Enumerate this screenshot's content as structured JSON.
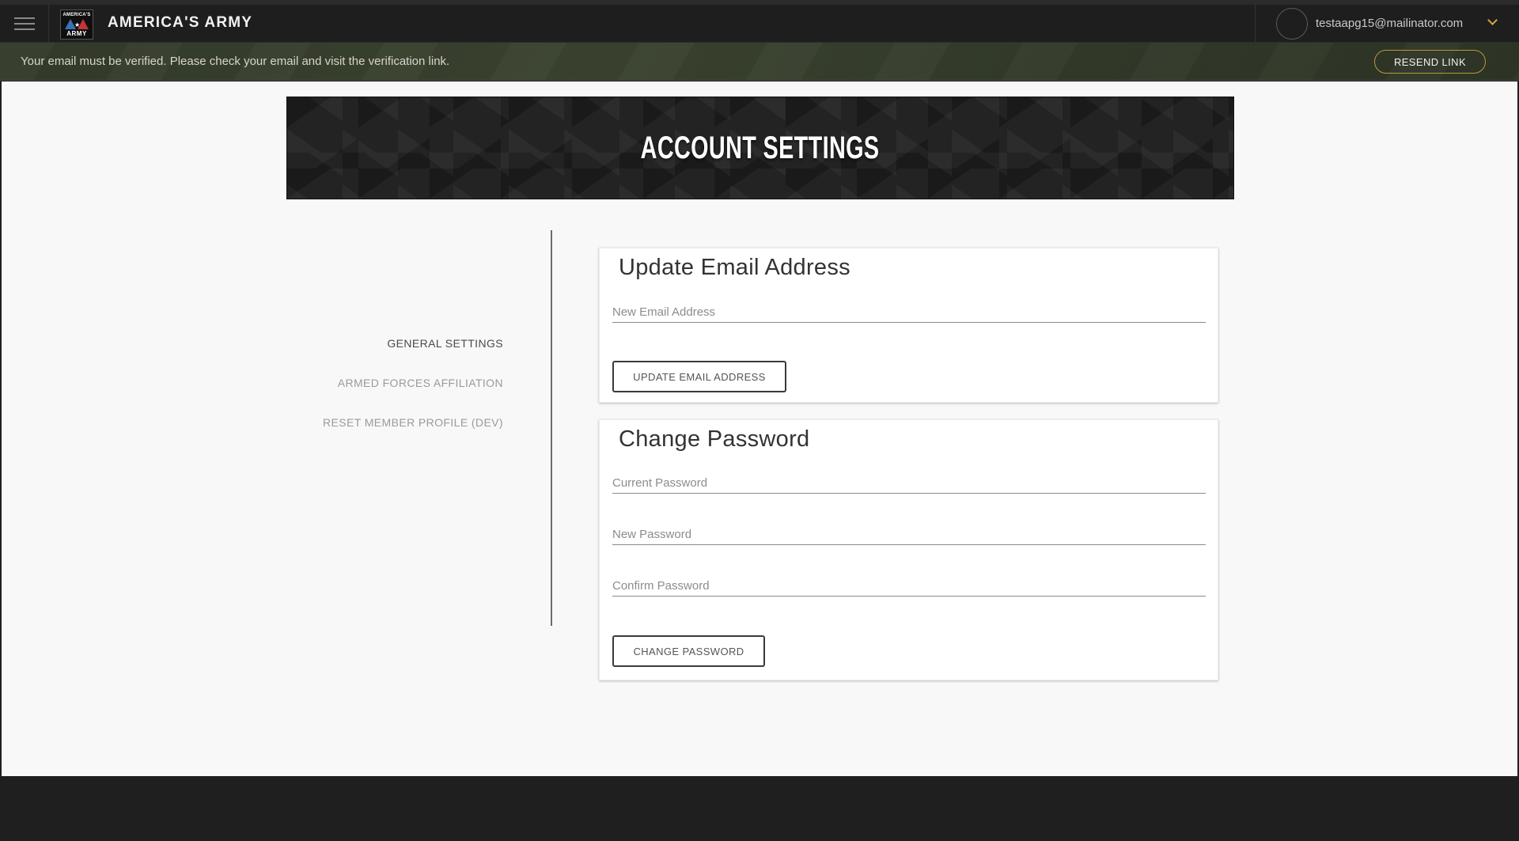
{
  "header": {
    "app_title": "AMERICA'S ARMY",
    "logo_top": "AMERICA'S",
    "logo_bottom": "ARMY",
    "user_email": "testaapg15@mailinator.com"
  },
  "banner": {
    "message": "Your email must be verified. Please check your email and visit the verification link.",
    "resend_label": "RESEND LINK"
  },
  "hero": {
    "title": "ACCOUNT SETTINGS"
  },
  "sidebar": {
    "items": [
      {
        "label": "GENERAL SETTINGS",
        "active": true
      },
      {
        "label": "ARMED FORCES AFFILIATION",
        "active": false
      },
      {
        "label": "RESET MEMBER PROFILE (DEV)",
        "active": false
      }
    ]
  },
  "email_card": {
    "title": "Update Email Address",
    "new_email_placeholder": "New Email Address",
    "new_email_value": "",
    "button_label": "UPDATE EMAIL ADDRESS"
  },
  "password_card": {
    "title": "Change Password",
    "current_placeholder": "Current Password",
    "new_placeholder": "New Password",
    "confirm_placeholder": "Confirm Password",
    "button_label": "CHANGE PASSWORD"
  },
  "colors": {
    "accent_gold": "#d8a93a",
    "banner_bg": "#3b4330",
    "header_bg": "#1e1e1e"
  },
  "icons": {
    "menu": "hamburger-icon",
    "user_menu": "chevron-down-icon",
    "avatar": "avatar-circle"
  }
}
